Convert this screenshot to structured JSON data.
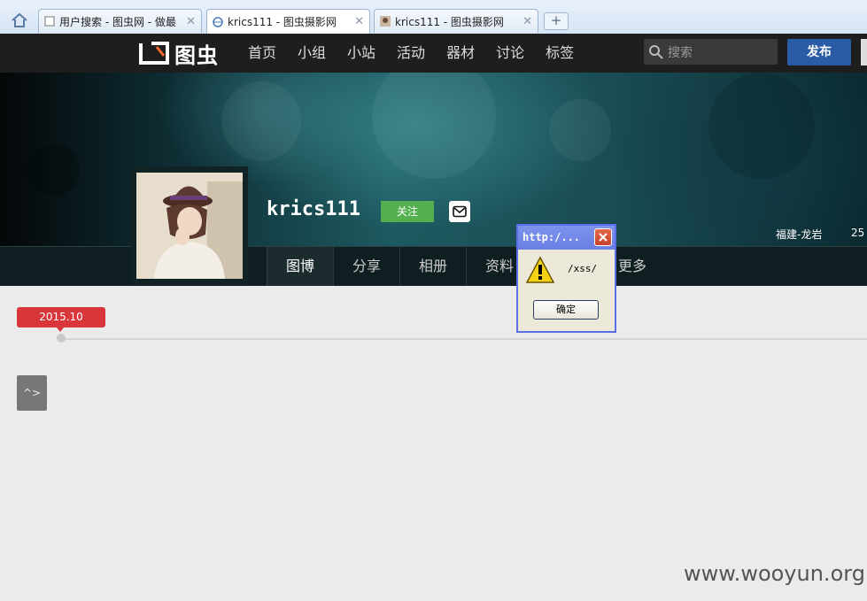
{
  "browser": {
    "tabs": [
      {
        "title": "用户搜索 - 图虫网 - 做最"
      },
      {
        "title": "krics111 - 图虫摄影网"
      },
      {
        "title": "krics111 - 图虫摄影网"
      }
    ],
    "new_tab_label": "+",
    "close_glyph": "✕"
  },
  "site": {
    "logo_text": "图虫",
    "nav": [
      "首页",
      "小组",
      "小站",
      "活动",
      "器材",
      "讨论",
      "标签"
    ],
    "search_placeholder": "搜索",
    "publish_label": "发布"
  },
  "profile": {
    "username": "krics111",
    "follow_label": "关注",
    "location": "福建-龙岩",
    "stat_partial": "25",
    "tabs": [
      "图博",
      "分享",
      "相册",
      "资料",
      "",
      "更多"
    ]
  },
  "timeline": {
    "date_label": "2015.10",
    "side_button": "^>"
  },
  "dialog": {
    "title": "http:/...",
    "message": "/xss/",
    "ok_label": "确定"
  },
  "watermark": "www.wooyun.org",
  "colors": {
    "accent_red": "#d8363b",
    "follow_green": "#54b04f",
    "publish_blue": "#2a5ba6"
  }
}
